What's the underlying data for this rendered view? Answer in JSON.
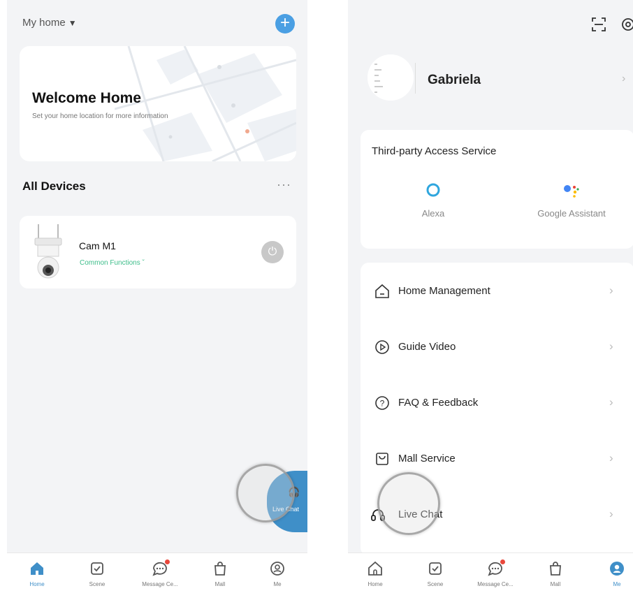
{
  "left": {
    "home_selector": "My home",
    "welcome_title": "Welcome Home",
    "welcome_subtitle": "Set your home location for more information",
    "section_title": "All Devices",
    "device": {
      "name": "Cam M1",
      "functions_label": "Common Functions ˇ"
    },
    "live_chat_label": "Live Chat",
    "tabs": [
      {
        "label": "Home",
        "icon": "home-icon",
        "active": true
      },
      {
        "label": "Scene",
        "icon": "scene-icon",
        "active": false
      },
      {
        "label": "Message Ce...",
        "icon": "message-icon",
        "active": false
      },
      {
        "label": "Mall",
        "icon": "mall-icon",
        "active": false
      },
      {
        "label": "Me",
        "icon": "me-icon",
        "active": false
      }
    ]
  },
  "right": {
    "user_name": "Gabriela",
    "third_party": {
      "title": "Third-party Access Service",
      "services": [
        {
          "label": "Alexa",
          "icon": "alexa-icon"
        },
        {
          "label": "Google Assistant",
          "icon": "google-assistant-icon"
        }
      ]
    },
    "menu": [
      {
        "label": "Home Management",
        "icon": "home-outline-icon"
      },
      {
        "label": "Guide Video",
        "icon": "play-circle-icon"
      },
      {
        "label": "FAQ & Feedback",
        "icon": "question-circle-icon"
      },
      {
        "label": "Mall Service",
        "icon": "shop-icon"
      },
      {
        "label": "Live Chat",
        "icon": "headset-icon"
      }
    ],
    "tabs": [
      {
        "label": "Home",
        "icon": "home-icon",
        "active": false
      },
      {
        "label": "Scene",
        "icon": "scene-icon",
        "active": false
      },
      {
        "label": "Message Ce...",
        "icon": "message-icon",
        "active": false
      },
      {
        "label": "Mall",
        "icon": "mall-icon",
        "active": false
      },
      {
        "label": "Me",
        "icon": "me-icon",
        "active": true
      }
    ]
  },
  "colors": {
    "accent": "#3f8fc8",
    "function_green": "#3dbd8a",
    "badge_red": "#e9473b",
    "background": "#f3f4f6"
  }
}
